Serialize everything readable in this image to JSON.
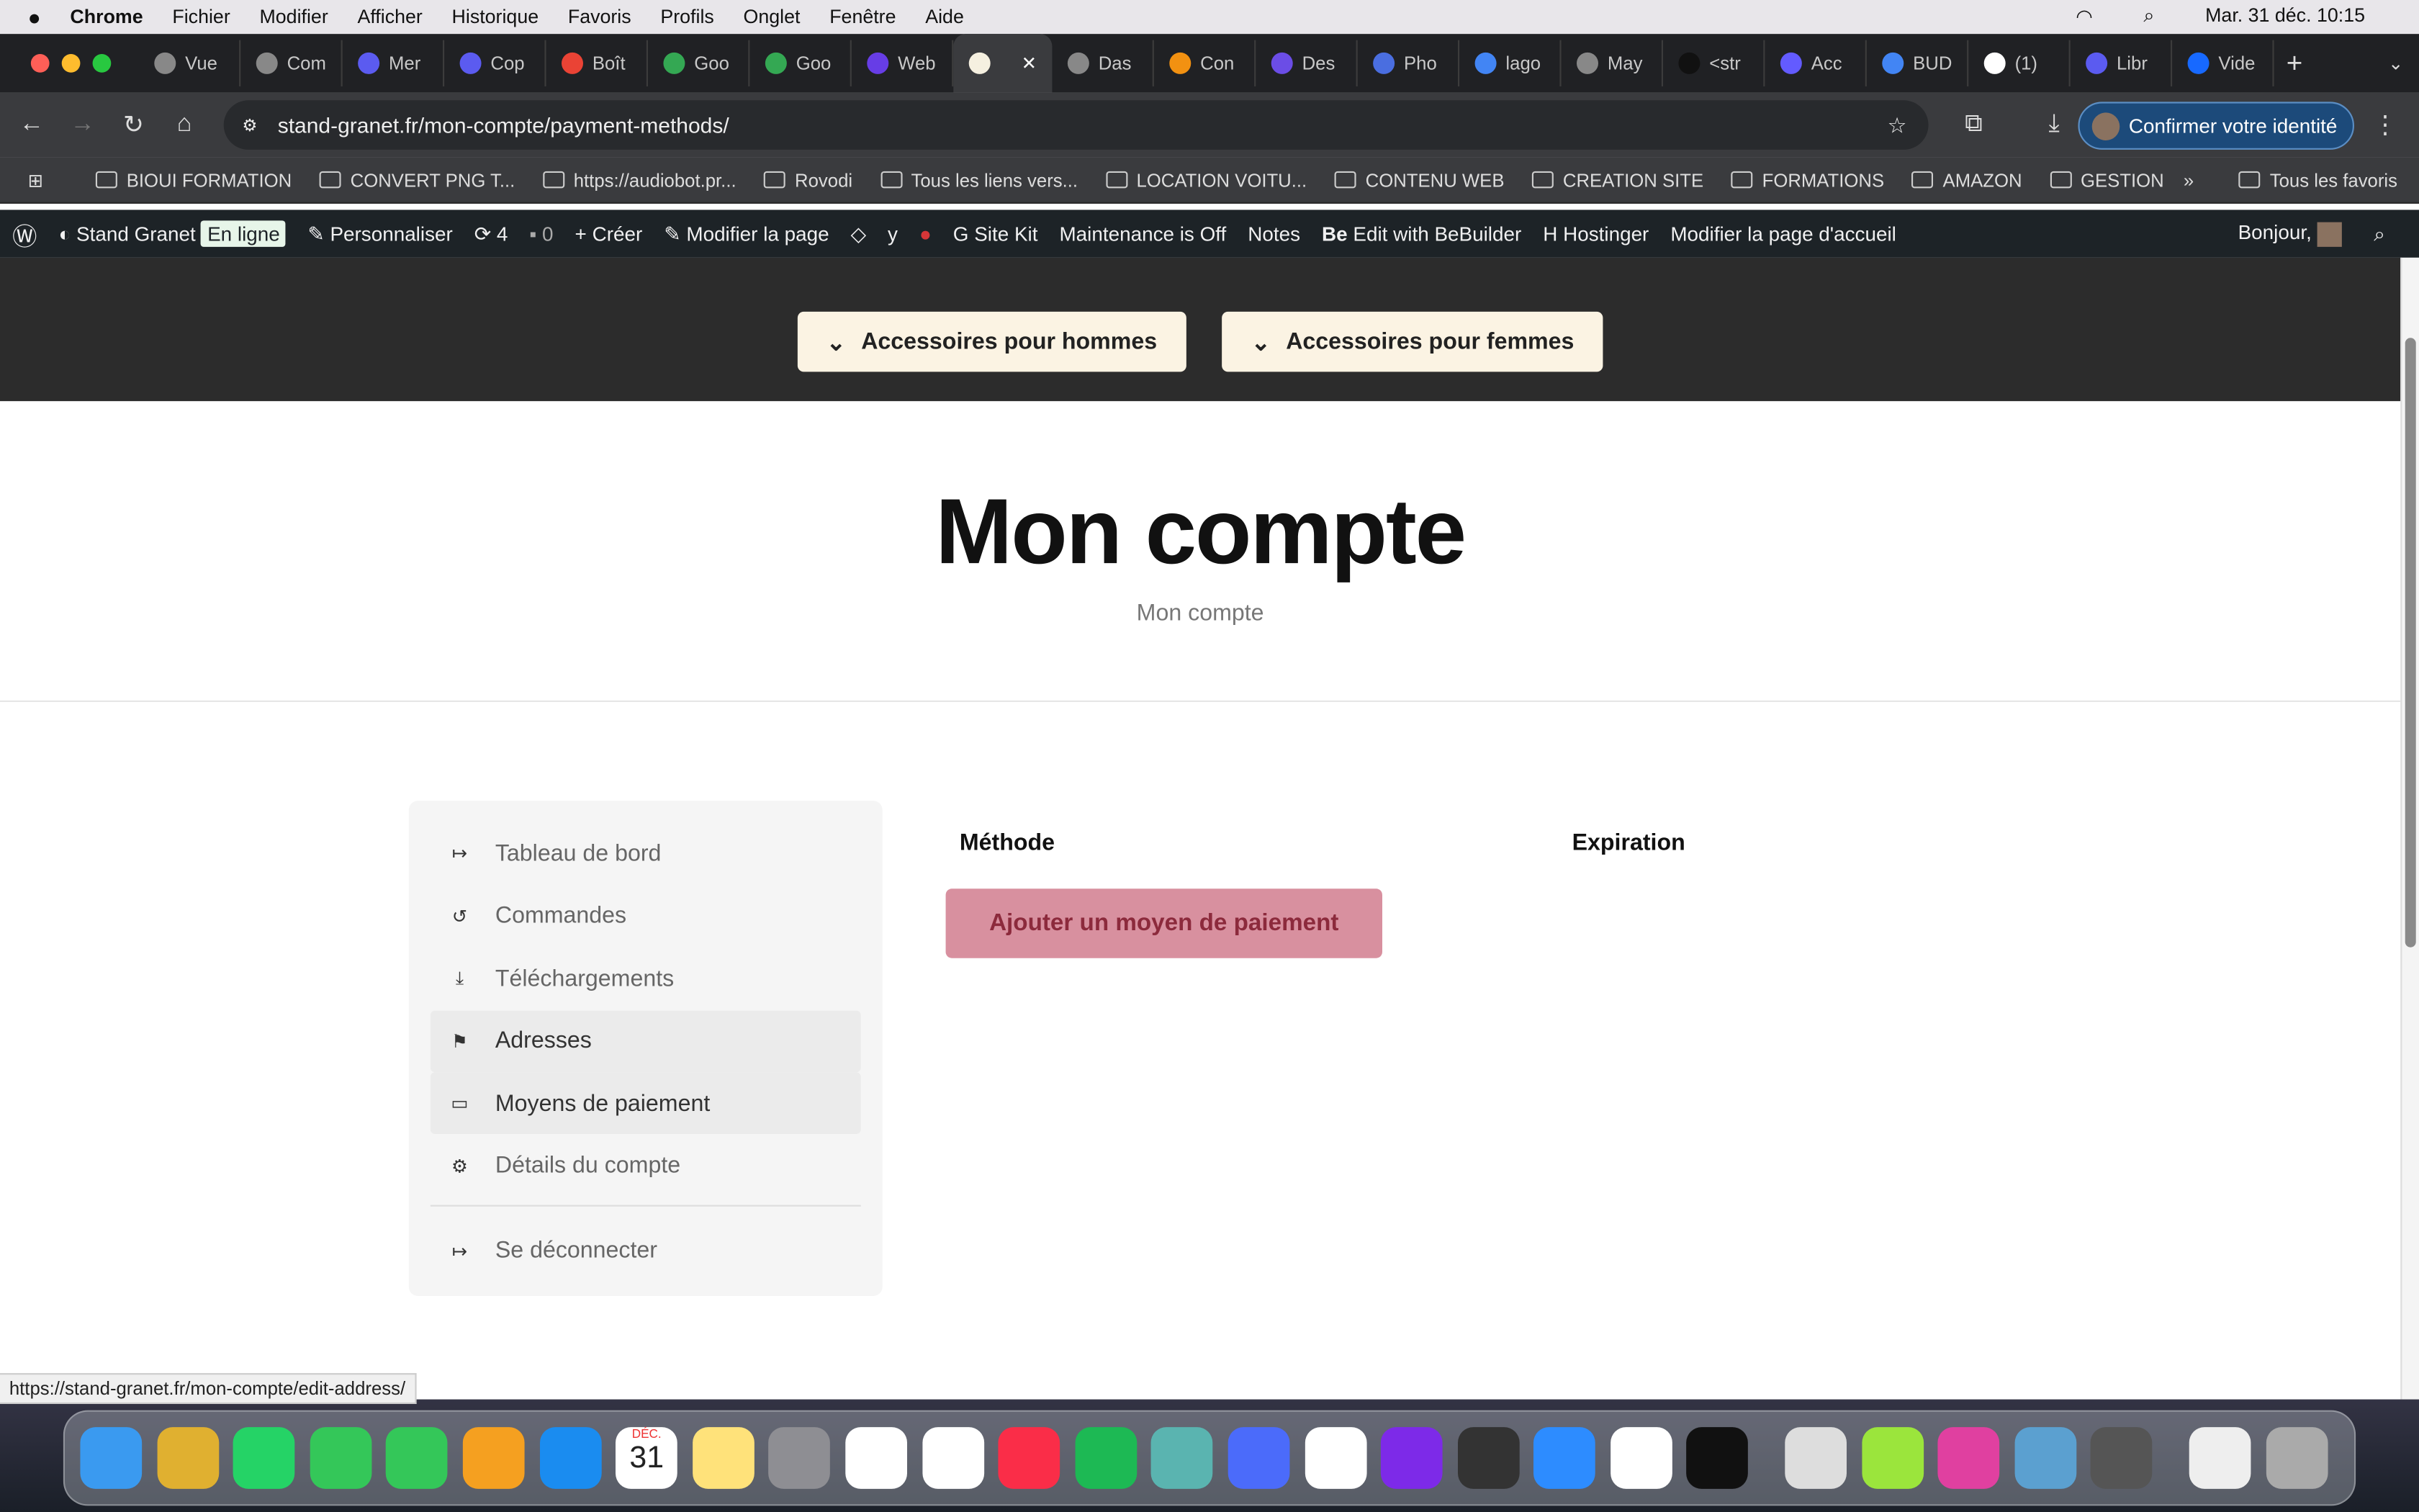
{
  "menubar": {
    "app": "Chrome",
    "items": [
      "Fichier",
      "Modifier",
      "Afficher",
      "Historique",
      "Favoris",
      "Profils",
      "Onglet",
      "Fenêtre",
      "Aide"
    ],
    "clock": "Mar. 31 déc. 10:15"
  },
  "tabs": [
    {
      "label": "Vue",
      "color": "#888"
    },
    {
      "label": "Com",
      "color": "#888"
    },
    {
      "label": "Mer",
      "color": "#5b5bf0"
    },
    {
      "label": "Cop",
      "color": "#5b5bf0"
    },
    {
      "label": "Boît",
      "color": "#ea4335"
    },
    {
      "label": "Goo",
      "color": "#34a853"
    },
    {
      "label": "Goo",
      "color": "#34a853"
    },
    {
      "label": "Web",
      "color": "#673de6"
    },
    {
      "label": "",
      "color": "#f5f0e0",
      "active": true
    },
    {
      "label": "Das",
      "color": "#888"
    },
    {
      "label": "Con",
      "color": "#f29111"
    },
    {
      "label": "Des",
      "color": "#6b4de6"
    },
    {
      "label": "Pho",
      "color": "#4a6ee0"
    },
    {
      "label": "lago",
      "color": "#4285f4"
    },
    {
      "label": "May",
      "color": "#888"
    },
    {
      "label": "<str",
      "color": "#111"
    },
    {
      "label": "Acc",
      "color": "#635bff"
    },
    {
      "label": "BUD",
      "color": "#4285f4"
    },
    {
      "label": "(1)",
      "color": "#fff"
    },
    {
      "label": "Libr",
      "color": "#5b5bf0"
    },
    {
      "label": "Vide",
      "color": "#1769ff"
    }
  ],
  "toolbar": {
    "url": "stand-granet.fr/mon-compte/payment-methods/",
    "confirm": "Confirmer votre identité"
  },
  "bookmarks": [
    "BIOUI FORMATION",
    "CONVERT PNG T...",
    "https://audiobot.pr...",
    "Rovodi",
    "Tous les liens vers...",
    "LOCATION VOITU...",
    "CONTENU WEB",
    "CREATION SITE",
    "FORMATIONS",
    "AMAZON",
    "GESTION"
  ],
  "bookmarks_all": "Tous les favoris",
  "wpbar": {
    "site": "Stand Granet",
    "status": "En ligne",
    "customize": "Personnaliser",
    "updates": "4",
    "comments": "0",
    "create": "Créer",
    "edit": "Modifier la page",
    "sitekit": "Site Kit",
    "maintenance": "Maintenance is Off",
    "notes": "Notes",
    "bebuilder": "Edit with BeBuilder",
    "hostinger": "Hostinger",
    "edit_home": "Modifier la page d'accueil",
    "greeting": "Bonjour,"
  },
  "header": {
    "men": "Accessoires pour hommes",
    "women": "Accessoires pour femmes"
  },
  "page": {
    "title": "Mon compte",
    "breadcrumb": "Mon compte"
  },
  "sidebar": [
    {
      "label": "Tableau de bord",
      "icon": "↦"
    },
    {
      "label": "Commandes",
      "icon": "↺"
    },
    {
      "label": "Téléchargements",
      "icon": "⤓"
    },
    {
      "label": "Adresses",
      "icon": "⚑"
    },
    {
      "label": "Moyens de paiement",
      "icon": "▭"
    },
    {
      "label": "Détails du compte",
      "icon": "⚙"
    }
  ],
  "logout": "Se déconnecter",
  "table": {
    "col_method": "Méthode",
    "col_expiration": "Expiration",
    "add_button": "Ajouter un moyen de paiement"
  },
  "status_url": "https://stand-granet.fr/mon-compte/edit-address/",
  "dock": [
    "finder",
    "launchpad",
    "whatsapp",
    "messages",
    "facetime",
    "photos",
    "app-store",
    "calendar",
    "notes",
    "system-settings",
    "freeform",
    "chrome",
    "music",
    "spotify",
    "app",
    "nordvpn",
    "capcut",
    "canva",
    "inkscape",
    "zoom",
    "chatgpt",
    "tr",
    "podcast",
    "mic",
    "pink",
    "preview",
    "calculator",
    "downloads",
    "trash"
  ],
  "dock_colors": [
    "#3a9af0",
    "#e0b030",
    "#25d366",
    "#34c759",
    "#34c759",
    "#f5a020",
    "#1a8cf0",
    "#ffffff",
    "#ffe27a",
    "#8e8e93",
    "#ffffff",
    "#ffffff",
    "#fa2d48",
    "#1db954",
    "#5ab4b0",
    "#4b6bfa",
    "#ffffff",
    "#7d2ae8",
    "#333333",
    "#2d8cff",
    "#ffffff",
    "#111111",
    "#dddddd",
    "#9be53c",
    "#e040a0",
    "#5ba0d0",
    "#555555",
    "#eeeeee",
    "#aaaaaa"
  ],
  "calendar": {
    "month": "DÉC.",
    "day": "31"
  }
}
